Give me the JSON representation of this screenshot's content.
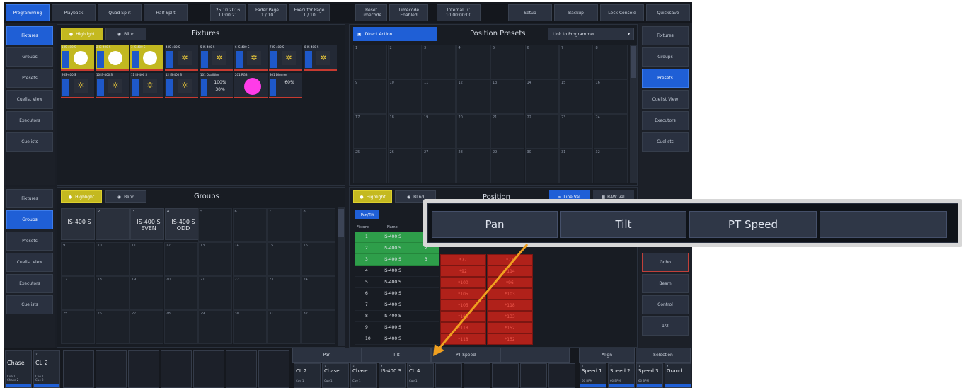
{
  "topbar": {
    "buttons": [
      {
        "label": "Programming",
        "active": true
      },
      {
        "label": "Playback"
      },
      {
        "label": "Quad Split"
      },
      {
        "label": "Half Split"
      },
      {
        "label": "25.10.2016\n11:00:21"
      },
      {
        "label": "Fader Page\n1 / 10"
      },
      {
        "label": "Executor Page\n1 / 10"
      },
      {
        "label": "Reset\nTimecode"
      },
      {
        "label": "Timecode\nEnabled"
      },
      {
        "label": "Internal TC\n10:00:00:00"
      },
      {
        "label": "Setup"
      },
      {
        "label": "Backup"
      },
      {
        "label": "Lock Console"
      },
      {
        "label": "Quicksave"
      }
    ]
  },
  "left_sidebar_top": [
    "Fixtures",
    "Groups",
    "Presets",
    "Cuelist View",
    "Executors",
    "Cuelists"
  ],
  "left_sidebar_bottom": [
    "Fixtures",
    "Groups",
    "Presets",
    "Cuelist View",
    "Executors",
    "Cuelists"
  ],
  "right_sidebar": [
    "Fixtures",
    "Groups",
    "Presets",
    "Cuelist View",
    "Executors",
    "Cuelists"
  ],
  "right_sidebar_lower": [
    "Gobo",
    "Beam",
    "Control",
    "1/2"
  ],
  "fixtures_panel": {
    "highlight": "Highlight",
    "blind": "Blind",
    "title": "Fixtures",
    "row1": [
      {
        "num": "1",
        "name": "IS-400 S",
        "kind": "dot"
      },
      {
        "num": "2",
        "name": "IS-400 S",
        "kind": "dot"
      },
      {
        "num": "3",
        "name": "IS-400 S",
        "kind": "dot"
      },
      {
        "num": "4",
        "name": "IS-400 S",
        "kind": "gobo"
      },
      {
        "num": "5",
        "name": "IS-400 S",
        "kind": "gobo"
      },
      {
        "num": "6",
        "name": "IS-400 S",
        "kind": "gobo"
      },
      {
        "num": "7",
        "name": "IS-400 S",
        "kind": "gobo"
      },
      {
        "num": "8",
        "name": "IS-400 S",
        "kind": "gobo"
      }
    ],
    "row2": [
      {
        "num": "9",
        "name": "IS-400 S",
        "kind": "gobo"
      },
      {
        "num": "10",
        "name": "IS-400 S",
        "kind": "gobo"
      },
      {
        "num": "11",
        "name": "IS-400 S",
        "kind": "gobo"
      },
      {
        "num": "12",
        "name": "IS-400 S",
        "kind": "gobo"
      },
      {
        "num": "101",
        "name": "DualDim",
        "kind": "pct",
        "value": "100%\n30%"
      },
      {
        "num": "201",
        "name": "RGB",
        "kind": "magenta"
      },
      {
        "num": "301",
        "name": "Dimmer",
        "kind": "pct",
        "value": "60%"
      }
    ]
  },
  "position_presets": {
    "direct_action": "Direct Action",
    "title": "Position Presets",
    "dropdown": "Link to Programmer",
    "cell_numbers": [
      "1",
      "2",
      "3",
      "4",
      "5",
      "6",
      "7",
      "8",
      "9",
      "10",
      "11",
      "12",
      "13",
      "14",
      "15",
      "16",
      "17",
      "18",
      "19",
      "20",
      "21",
      "22",
      "23",
      "24",
      "25",
      "26",
      "27",
      "28",
      "29",
      "30",
      "31",
      "32"
    ]
  },
  "groups_panel": {
    "highlight": "Highlight",
    "blind": "Blind",
    "title": "Groups",
    "groups": [
      {
        "num": "1",
        "name": "IS-400 S"
      },
      {
        "num": "2",
        "name": ""
      },
      {
        "num": "3",
        "name": "IS-400 S\nEVEN"
      },
      {
        "num": "4",
        "name": "IS-400 S\nODD"
      }
    ],
    "cell_numbers": [
      "5",
      "6",
      "7",
      "8",
      "9",
      "10",
      "11",
      "12",
      "13",
      "14",
      "15",
      "16",
      "17",
      "18",
      "19",
      "20",
      "21",
      "22",
      "23",
      "24",
      "25",
      "26",
      "27",
      "28",
      "29",
      "30",
      "31",
      "32"
    ]
  },
  "position_panel": {
    "highlight": "Highlight",
    "blind": "Blind",
    "title": "Position",
    "line_val": "Line Val.",
    "raw_val": "RAW Val.",
    "pan_tilt_tab": "Pan/Tilt",
    "col_fixture": "Fixture",
    "col_name": "Name",
    "rows": [
      {
        "fixture": "1",
        "name": "IS-400 S",
        "sel": true
      },
      {
        "fixture": "2",
        "name": "IS-400 S",
        "sel": true,
        "extra": "2"
      },
      {
        "fixture": "3",
        "name": "IS-400 S",
        "sel": true,
        "extra": "3"
      },
      {
        "fixture": "4",
        "name": "IS-400 S"
      },
      {
        "fixture": "5",
        "name": "IS-400 S"
      },
      {
        "fixture": "6",
        "name": "IS-400 S"
      },
      {
        "fixture": "7",
        "name": "IS-400 S"
      },
      {
        "fixture": "8",
        "name": "IS-400 S"
      },
      {
        "fixture": "9",
        "name": "IS-400 S"
      },
      {
        "fixture": "10",
        "name": "IS-400 S"
      }
    ],
    "red_values": [
      [
        "*77",
        "*77"
      ],
      [
        "*92",
        "*114"
      ],
      [
        "*100",
        "*96"
      ],
      [
        "*105",
        "*103"
      ],
      [
        "*105",
        "*118"
      ],
      [
        "*105",
        "*133"
      ],
      [
        "*118",
        "*152"
      ],
      [
        "*118",
        "*152"
      ]
    ]
  },
  "bottom_bar": {
    "pan": "Pan",
    "tilt": "Tilt",
    "pt_speed": "PT Speed",
    "align": "Align",
    "selection": "Selection"
  },
  "left_executors": [
    {
      "name": "Chase",
      "top": "1",
      "sub": "Cue 1\nChase 2"
    },
    {
      "name": "CL 2",
      "top": "2",
      "sub": "Cue 1\nCue 2"
    }
  ],
  "bottom_executors": [
    {
      "num": "1",
      "name": "CL 2",
      "sub": "Cue 1"
    },
    {
      "num": "2",
      "name": "Chase",
      "sub": "Cue 1"
    },
    {
      "num": "3",
      "name": "Chase",
      "sub": "Cue 1"
    },
    {
      "num": "4",
      "name": "IS-400 S",
      "sub": ""
    },
    {
      "num": "5",
      "name": "CL 4",
      "sub": "Cue 1"
    }
  ],
  "speed_executors": [
    {
      "num": "1",
      "name": "Speed 1",
      "sub": "60 BPM"
    },
    {
      "num": "2",
      "name": "Speed 2",
      "sub": "60 BPM"
    },
    {
      "num": "3",
      "name": "Speed 3",
      "sub": "60 BPM"
    },
    {
      "num": "4",
      "name": "Grand",
      "sub": ""
    }
  ],
  "callout": {
    "pan": "Pan",
    "tilt": "Tilt",
    "pt_speed": "PT Speed",
    "empty": ""
  },
  "colors": {
    "accent": "#1f5fd6",
    "highlight": "#c4b920",
    "selected_row": "#2e9e4a",
    "value_cell": "#b0211a",
    "arrow": "#f0a020"
  }
}
